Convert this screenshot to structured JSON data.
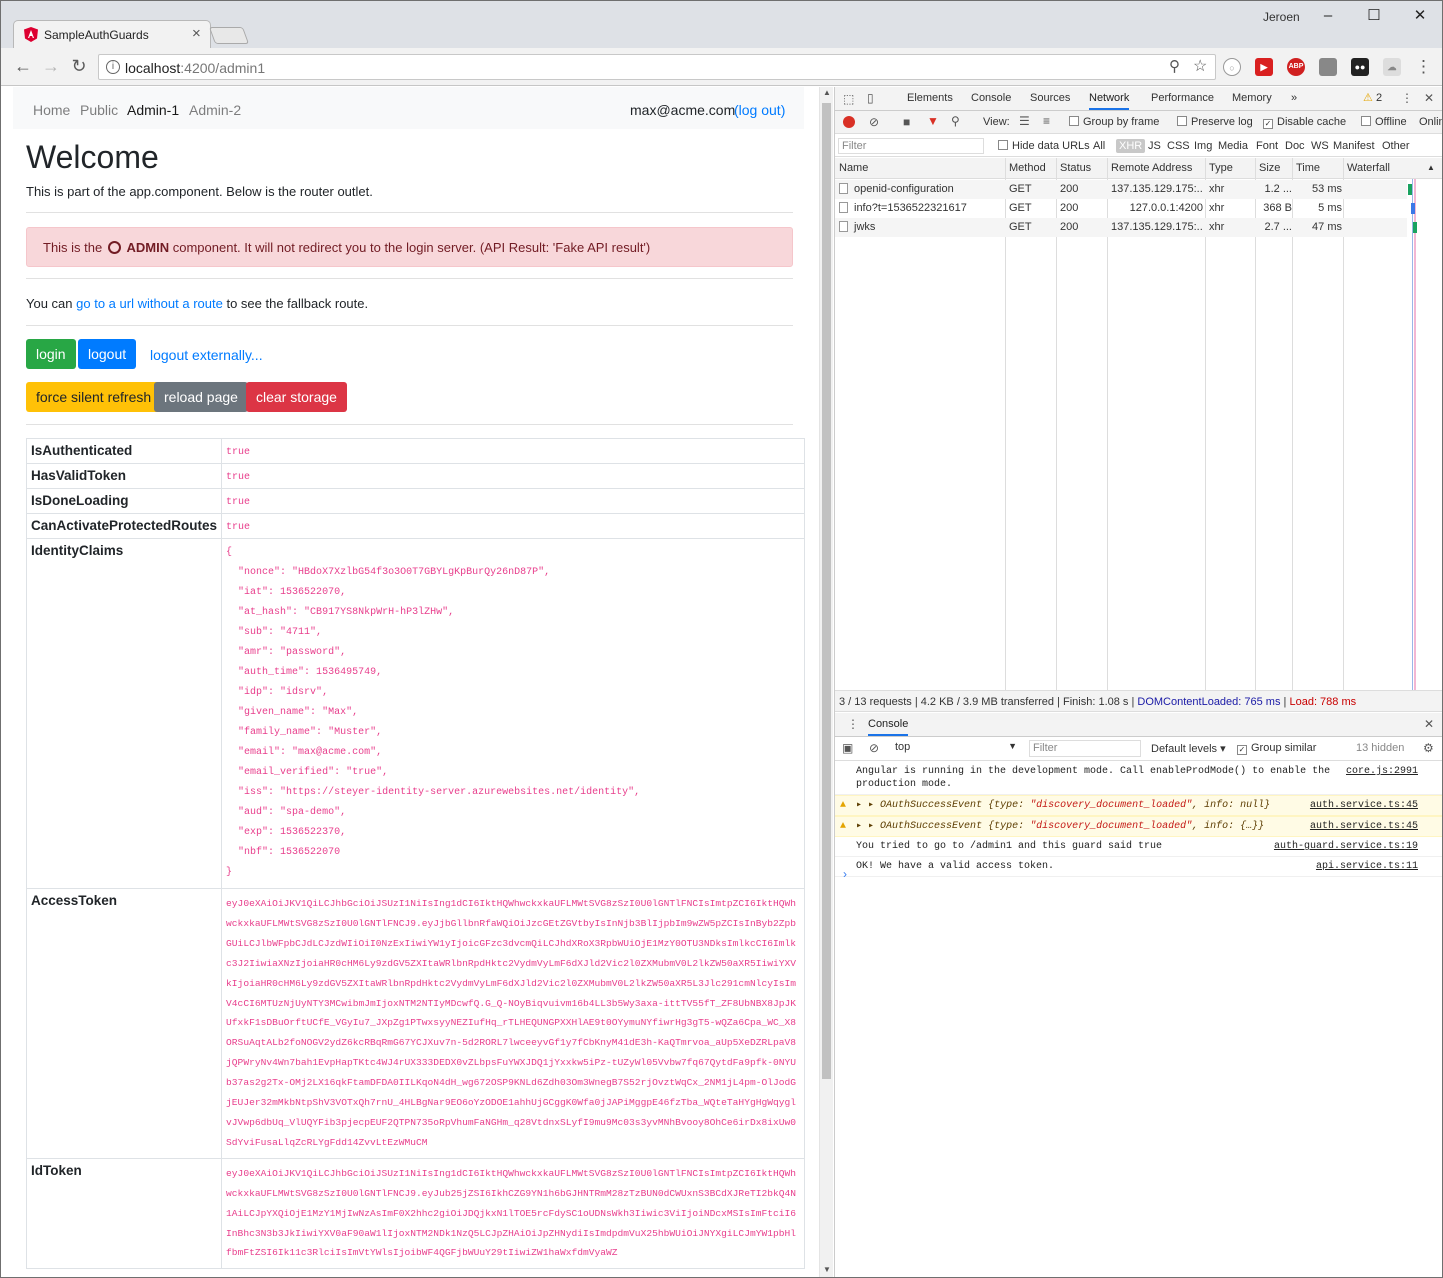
{
  "browser": {
    "tab_title": "SampleAuthGuards",
    "user": "Jeroen",
    "url_host": "localhost",
    "url_path": ":4200/admin1"
  },
  "nav": {
    "links": [
      "Home",
      "Public",
      "Admin-1",
      "Admin-2"
    ],
    "email": "max@acme.com",
    "logout": "(log out)"
  },
  "page": {
    "title": "Welcome",
    "subtitle": "This is part of the app.component. Below is the router outlet.",
    "alert_prefix": "This is the",
    "alert_bold": "ADMIN",
    "alert_suffix": "component. It will not redirect you to the login server. (API Result: 'Fake API result')",
    "para_prefix": "You can",
    "para_link": "go to a url without a route",
    "para_suffix": "to see the fallback route.",
    "buttons": {
      "login": "login",
      "logout": "logout",
      "logout_ext": "logout externally...",
      "silent": "force silent refresh",
      "reload": "reload page",
      "clear": "clear storage"
    }
  },
  "table": {
    "rows": [
      {
        "key": "IsAuthenticated",
        "value": "true"
      },
      {
        "key": "HasValidToken",
        "value": "true"
      },
      {
        "key": "IsDoneLoading",
        "value": "true"
      },
      {
        "key": "CanActivateProtectedRoutes",
        "value": "true"
      }
    ],
    "claims_key": "IdentityClaims",
    "claims": "{\n  \"nonce\": \"HBdoX7XzlbG54f3o3O0T7GBYLgKpBurQy26nD87P\",\n  \"iat\": 1536522070,\n  \"at_hash\": \"CB917YS8NkpWrH-hP3lZHw\",\n  \"sub\": \"4711\",\n  \"amr\": \"password\",\n  \"auth_time\": 1536495749,\n  \"idp\": \"idsrv\",\n  \"given_name\": \"Max\",\n  \"family_name\": \"Muster\",\n  \"email\": \"max@acme.com\",\n  \"email_verified\": \"true\",\n  \"iss\": \"https://steyer-identity-server.azurewebsites.net/identity\",\n  \"aud\": \"spa-demo\",\n  \"exp\": 1536522370,\n  \"nbf\": 1536522070\n}",
    "access_key": "AccessToken",
    "access_token": "eyJ0eXAiOiJKV1QiLCJhbGciOiJSUzI1NiIsIng1dCI6IktHQWhwckxkaUFLMWtSVG8zSzI0U0lGNTlFNCIsImtpZCI6IktHQWhwckxkaUFLMWtSVG8zSzI0U0lGNTlFNCJ9.eyJjbGllbnRfaWQiOiJzcGEtZGVtbyIsInNjb3BlIjpbIm9wZW5pZCIsInByb2ZpbGUiLCJlbWFpbCJdLCJzdWIiOiI0NzExIiwiYW1yIjoicGFzc3dvcmQiLCJhdXRoX3RpbWUiOjE1MzY0OTU3NDksImlkcCI6Imlkc3J2IiwiaXNzIjoiaHR0cHM6Ly9zdGV5ZXItaWRlbnRpdHktc2VydmVyLmF6dXJld2Vic2l0ZXMubmV0L2lkZW50aXR5IiwiYXVkIjoiaHR0cHM6Ly9zdGV5ZXItaWRlbnRpdHktc2VydmVyLmF6dXJld2Vic2l0ZXMubmV0L2lkZW50aXR5L3Jlc291cmNlcyIsImV4cCI6MTUzNjUyNTY3MCwibmJmIjoxNTM2NTIyMDcwfQ.G_Q-NOyBiqvuivm16b4LL3b5Wy3axa-ittTV55fT_ZF8UbNBX8JpJKUfxkF1sDBuOrftUCfE_VGyIu7_JXpZg1PTwxsyyNEZIufHq_rTLHEQUNGPXXHlAE9t0OYymuNYfiwrHg3gT5-wQZa6Cpa_WC_X8ORSuAqtALb2foNOGV2ydZ6kcRBqRmG67YCJXuv7n-5d2RORL7lwceeyvGf1y7fCbKnyM41dE3h-KaQTmrvoa_aUp5XeDZRLpaV8jQPWryNv4Wn7bah1EvpHapTKtc4WJ4rUX333DEDX0vZLbpsFuYWXJDQ1jYxxkw5iPz-tUZyWl05Vvbw7fq67QytdFa9pfk-0NYUb37as2g2Tx-OMj2LX16qkFtamDFDA0IILKqoN4dH_wg672OSP9KNLd6Zdh03Om3WnegB7S52rjOvztWqCx_2NM1jL4pm-OlJodGjEUJer32mMkbNtpShV3VOTxQh7rnU_4HLBgNar9EO6oYzODOE1ahhUjGCggK0Wfa0jJAPiMggpE46fzTba_WQteTaHYgHgWqyglvJVwp6dbUq_VlUQYFib3pjecpEUF2QTPN735oRpVhumFaNGHm_q28VtdnxSLyfI9mu9Mc03s3yvMNhBvooy8OhCe6irDx8ixUw0SdYviFusaLlqZcRLYgFdd14ZvvLtEzWMuCM",
    "id_key": "IdToken",
    "id_token": "eyJ0eXAiOiJKV1QiLCJhbGciOiJSUzI1NiIsIng1dCI6IktHQWhwckxkaUFLMWtSVG8zSzI0U0lGNTlFNCIsImtpZCI6IktHQWhwckxkaUFLMWtSVG8zSzI0U0lGNTlFNCJ9.eyJub25jZSI6IkhCZG9YN1h6bGJHNTRmM28zTzBUN0dCWUxnS3BCdXJReTI2bkQ4N1AiLCJpYXQiOjE1MzY1MjIwNzAsImF0X2hhc2giOiJDQjkxN1lTOE5rcFdySC1oUDNsWkh3Iiwic3ViIjoiNDcxMSIsImFtciI6InBhc3N3b3JkIiwiYXV0aF90aW1lIjoxNTM2NDk1NzQ5LCJpZHAiOiJpZHNydiIsImdpdmVuX25hbWUiOiJNYXgiLCJmYW1pbHlfbmFtZSI6Ik11c3RlciIsImVtYWlsIjoibWF4QGFjbWUuY29tIiwiZW1haWxfdmVyaWZ"
  },
  "devtools": {
    "tabs": [
      "Elements",
      "Console",
      "Sources",
      "Network",
      "Performance",
      "Memory"
    ],
    "warnings": "2",
    "view_label": "View:",
    "group_by_frame": "Group by frame",
    "preserve_log": "Preserve log",
    "disable_cache": "Disable cache",
    "offline": "Offline",
    "online": "Onlin",
    "filter_placeholder": "Filter",
    "hide_data_urls": "Hide data URLs",
    "types": [
      "All",
      "XHR",
      "JS",
      "CSS",
      "Img",
      "Media",
      "Font",
      "Doc",
      "WS",
      "Manifest",
      "Other"
    ],
    "columns": [
      "Name",
      "Method",
      "Status",
      "Remote Address",
      "Type",
      "Size",
      "Time",
      "Waterfall"
    ],
    "requests": [
      {
        "name": "openid-configuration",
        "method": "GET",
        "status": "200",
        "addr": "137.135.129.175:...",
        "type": "xhr",
        "size": "1.2 ...",
        "time": "53 ms",
        "wf": 0.15
      },
      {
        "name": "info?t=1536522321617",
        "method": "GET",
        "status": "200",
        "addr": "127.0.0.1:4200",
        "type": "xhr",
        "size": "368 B",
        "time": "5 ms",
        "wf": 0.5
      },
      {
        "name": "jwks",
        "method": "GET",
        "status": "200",
        "addr": "137.135.129.175:...",
        "type": "xhr",
        "size": "2.7 ...",
        "time": "47 ms",
        "wf": 0.8
      }
    ],
    "summary": "3 / 13 requests  |  4.2 KB / 3.9 MB transferred  |  Finish: 1.08 s  |",
    "dom_loaded": "DOMContentLoaded: 765 ms",
    "load": "Load: 788 ms",
    "drawer_tab": "Console",
    "context": "top",
    "console_filter": "Filter",
    "default_levels": "Default levels ▾",
    "group_similar": "Group similar",
    "hidden": "13 hidden",
    "console": [
      {
        "text1": "Angular is running in the development mode. Call enableProdMode() to enable the",
        "text2": "production mode.",
        "src": "core.js:2991"
      },
      {
        "evt": "OAuthSuccessEvent",
        "t1": "{type: ",
        "str": "\"discovery_document_loaded\"",
        "t2": ", info: ",
        "info": "null}",
        "src": "auth.service.ts:45"
      },
      {
        "evt": "OAuthSuccessEvent",
        "t1": "{type: ",
        "str": "\"discovery_document_loaded\"",
        "t2": ", info: ",
        "info": "{…}}",
        "src": "auth.service.ts:45"
      },
      {
        "text1": "You tried to go to /admin1 and this guard said true",
        "src": "auth-guard.service.ts:19"
      },
      {
        "text1": "OK! We have a valid access token.",
        "src": "api.service.ts:11"
      }
    ]
  }
}
